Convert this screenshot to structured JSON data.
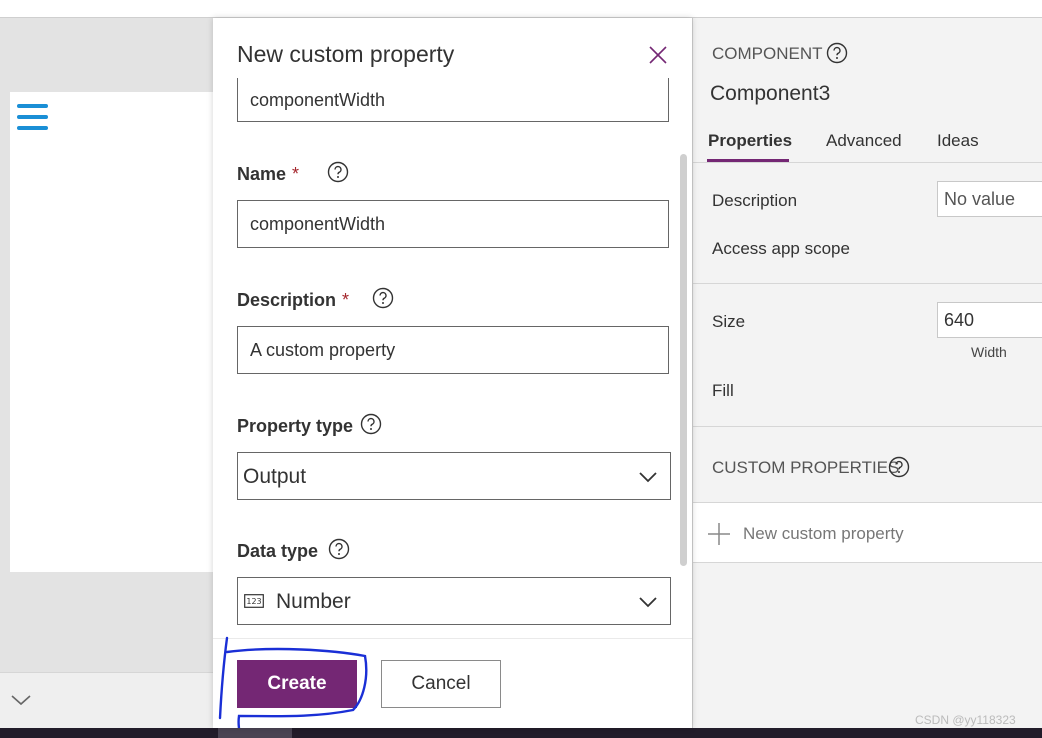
{
  "dialog": {
    "title": "New custom property",
    "display_name_value": "componentWidth",
    "name_label": "Name",
    "name_value": "componentWidth",
    "description_label": "Description",
    "description_value": "A custom property",
    "property_type_label": "Property type",
    "property_type_value": "Output",
    "data_type_label": "Data type",
    "data_type_value": "Number",
    "required_marker": "*",
    "create_label": "Create",
    "cancel_label": "Cancel"
  },
  "panel": {
    "section_label": "COMPONENT",
    "component_name": "Component3",
    "tabs": [
      {
        "label": "Properties",
        "active": true
      },
      {
        "label": "Advanced",
        "active": false
      },
      {
        "label": "Ideas",
        "active": false
      }
    ],
    "description_label": "Description",
    "description_placeholder": "No value",
    "access_label": "Access app scope",
    "size_label": "Size",
    "size_value": "640",
    "width_label": "Width",
    "fill_label": "Fill",
    "custom_props_label": "CUSTOM PROPERTIES",
    "new_prop_label": "New custom property"
  },
  "watermark": "CSDN @yy118323",
  "colors": {
    "accent": "#742774",
    "hamburger": "#1a8fd6",
    "annotation": "#1a2fd6",
    "required": "#a4262c"
  },
  "icons": [
    "close-icon",
    "help-icon",
    "chevron-down-icon",
    "number-icon",
    "plus-icon",
    "hamburger-menu-icon"
  ]
}
